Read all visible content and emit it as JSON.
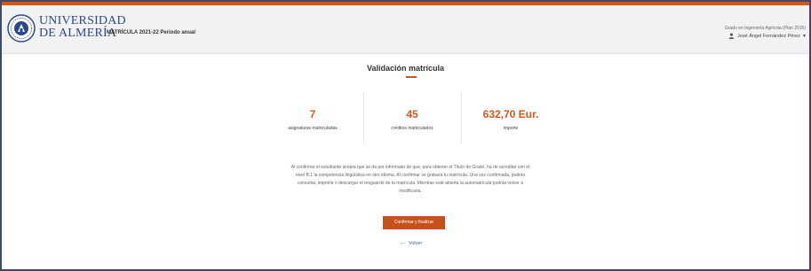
{
  "header": {
    "logo_line1": "UNIVERSIDAD",
    "logo_line2": "DE ALMERÍA",
    "title": "MATRÍCULA 2021-22 Periodo anual",
    "degree": "Grado en Ingeniería Agrícola (Plan 2015)",
    "user_name": "José Ángel Fernández Pérez"
  },
  "main": {
    "title": "Validación matrícula",
    "stats": [
      {
        "value": "7",
        "label": "asignaturas matriculadas"
      },
      {
        "value": "45",
        "label": "créditos matriculados"
      },
      {
        "value": "632,70 Eur.",
        "label": "importe"
      }
    ],
    "description": "Al confirmar el estudiante acepta que se da por informado de que, para obtener el Título de Grado, ha de acreditar con el nivel B.1 la competencia lingüística en otro idioma. Al confirmar se grabará tu matrícula. Una vez confirmada, podrás consultar, imprimir o descargar el resguardo de tu matrícula. Mientras esté abierta la automatrícula podrás volver a modificarla.",
    "confirm_label": "Confirmar y finalizar",
    "back_label": "Volver"
  },
  "colors": {
    "accent": "#d1591f",
    "brand_blue": "#2b4a8c",
    "link": "#3b5fa0"
  },
  "icons": {
    "user": "user-icon",
    "caret": "caret-down-icon",
    "back": "arrow-left-icon"
  }
}
